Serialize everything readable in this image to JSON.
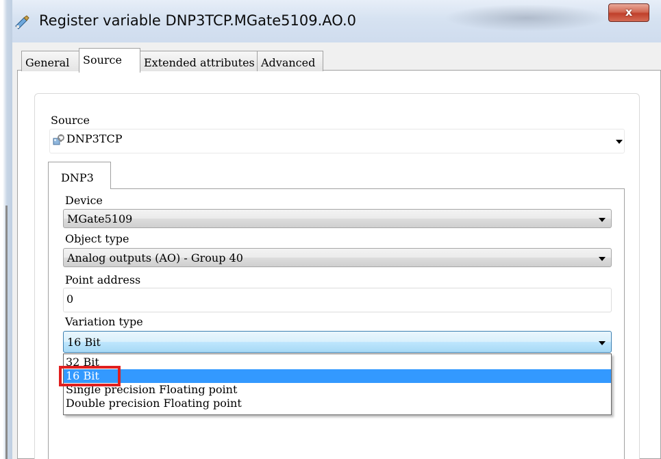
{
  "window": {
    "title": "Register variable DNP3TCP.MGate5109.AO.0",
    "close_label": "x"
  },
  "tabs": [
    {
      "label": "General"
    },
    {
      "label": "Source",
      "active": true
    },
    {
      "label": "Extended attributes"
    },
    {
      "label": "Advanced"
    }
  ],
  "source": {
    "label": "Source",
    "value": "DNP3TCP",
    "icon": "driver-icon"
  },
  "protocol_tab": {
    "label": "DNP3"
  },
  "dnp3": {
    "device": {
      "label": "Device",
      "value": "MGate5109"
    },
    "object_type": {
      "label": "Object type",
      "value": "Analog outputs (AO) - Group 40"
    },
    "point_address": {
      "label": "Point address",
      "value": "0"
    },
    "variation_type": {
      "label": "Variation type",
      "value": "16 Bit",
      "options": [
        "32 Bit",
        "16 Bit",
        "Single precision Floating point",
        "Double precision Floating point"
      ],
      "selected_index": 1
    }
  },
  "colors": {
    "selection": "#3399ff",
    "annotation": "#e01f1f",
    "close_button": "#c0402b"
  }
}
